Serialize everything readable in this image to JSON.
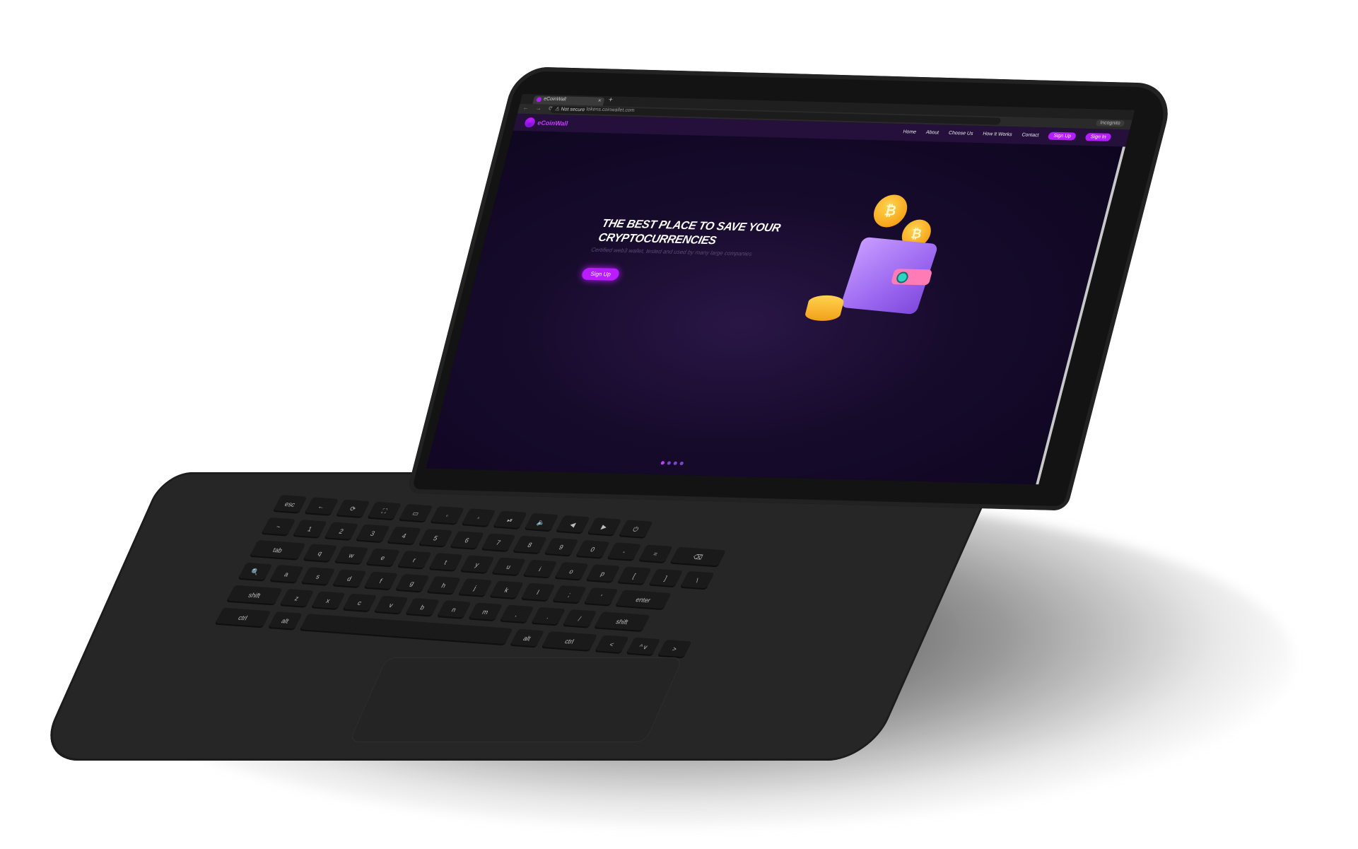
{
  "browser": {
    "tab_title": "eCoinWall",
    "new_tab": "+",
    "close": "×",
    "nav_icons": "← → ⟳",
    "not_secure": "⚠ Not secure",
    "url": "tokens.coinwallet.com",
    "profile": "Incognito"
  },
  "site": {
    "logo": "eCoinWall",
    "nav": [
      "Home",
      "About",
      "Choose Us",
      "How It Works",
      "Contact"
    ],
    "signup": "Sign Up",
    "signin": "Sign In"
  },
  "hero": {
    "title": "THE BEST PLACE TO SAVE YOUR CRYPTOCURRENCIES",
    "subtitle": "Certified web3 wallet, tested and used by many large companies",
    "cta": "Sign Up",
    "slide_count": 4,
    "active_slide": 1,
    "coin_symbol": "₿"
  },
  "keyboard": {
    "rows": [
      [
        "esc",
        "←",
        "⟳",
        "⛶",
        "▭",
        "◦",
        "◦",
        "⏯",
        "🔈",
        "◀",
        "▶",
        "⏻"
      ],
      [
        "~",
        "1",
        "2",
        "3",
        "4",
        "5",
        "6",
        "7",
        "8",
        "9",
        "0",
        "-",
        "=",
        "⌫"
      ],
      [
        "tab",
        "q",
        "w",
        "e",
        "r",
        "t",
        "y",
        "u",
        "i",
        "o",
        "p",
        "[",
        "]",
        "\\"
      ],
      [
        "🔍",
        "a",
        "s",
        "d",
        "f",
        "g",
        "h",
        "j",
        "k",
        "l",
        ";",
        "'",
        "enter"
      ],
      [
        "shift",
        "z",
        "x",
        "c",
        "v",
        "b",
        "n",
        "m",
        ",",
        ".",
        "/",
        "shift"
      ],
      [
        "ctrl",
        "alt",
        "",
        "alt",
        "ctrl",
        "<",
        "^ v",
        ">"
      ]
    ]
  },
  "colors": {
    "accent": "#b81cff",
    "screen_bg": "#0e0720",
    "laptop": "#262626"
  }
}
